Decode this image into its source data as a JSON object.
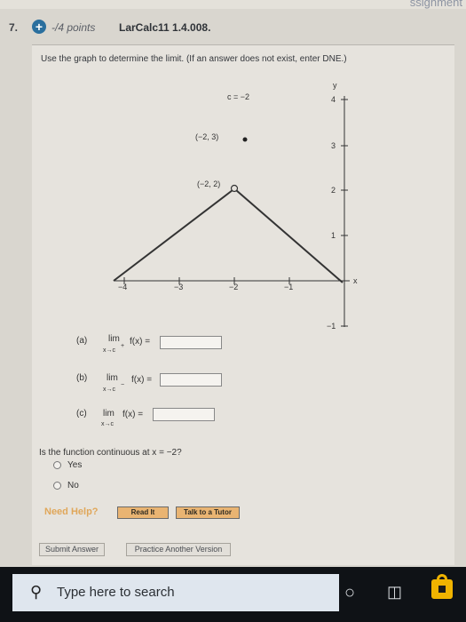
{
  "page": {
    "top_fragment": "ssignment"
  },
  "header": {
    "question_number": "7.",
    "points": "-/4 points",
    "question_id": "LarCalc11 1.4.008."
  },
  "prompt": "Use the graph to determine the limit. (If an answer does not exist, enter DNE.)",
  "graph": {
    "c_label": "c = −2",
    "point_filled_label": "(−2, 3)",
    "point_open_label": "(−2, 2)",
    "x_axis_label": "x",
    "y_axis_label": "y",
    "x_ticks": [
      "−4",
      "−3",
      "−2",
      "−1"
    ],
    "y_ticks": [
      "4",
      "3",
      "2",
      "1",
      "−1"
    ]
  },
  "parts": [
    {
      "label": "(a)",
      "lim": "lim",
      "fx": "f(x) =",
      "sub": "x→c",
      "sup": "+"
    },
    {
      "label": "(b)",
      "lim": "lim",
      "fx": "f(x) =",
      "sub": "x→c",
      "sup": "−"
    },
    {
      "label": "(c)",
      "lim": "lim",
      "fx": "f(x) =",
      "sub": "x→c",
      "sup": ""
    }
  ],
  "continuity": {
    "question": "Is the function continuous at x = −2?",
    "options": [
      "Yes",
      "No"
    ]
  },
  "help": {
    "label": "Need Help?",
    "read_it": "Read It",
    "talk_tutor": "Talk to a Tutor"
  },
  "footer": {
    "submit": "Submit Answer",
    "practice": "Practice Another Version"
  },
  "taskbar": {
    "search_placeholder": "Type here to search",
    "icons": [
      "search-icon",
      "cortana-icon",
      "task-view-icon",
      "store-icon"
    ]
  }
}
